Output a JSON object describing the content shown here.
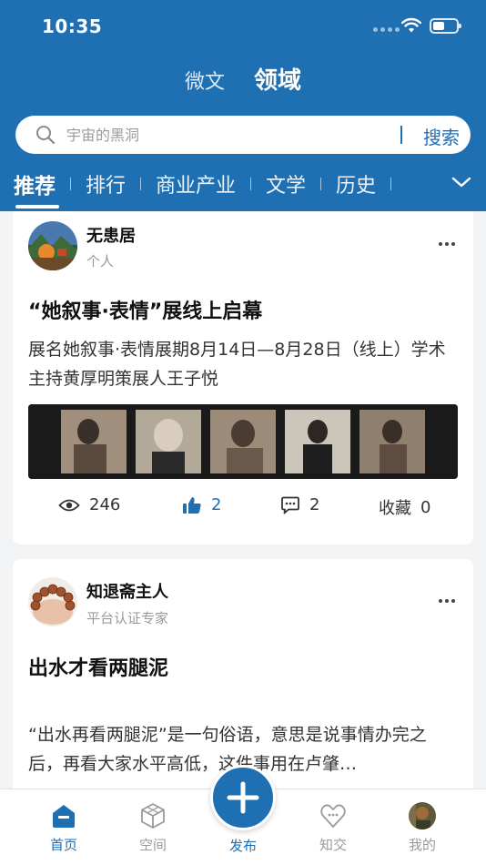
{
  "status_bar": {
    "time": "10:35"
  },
  "header": {
    "tabs": [
      {
        "label": "微文",
        "active": false
      },
      {
        "label": "领域",
        "active": true
      }
    ],
    "search": {
      "placeholder": "宇宙的黑洞",
      "button_label": "搜索"
    },
    "categories": [
      {
        "label": "推荐",
        "active": true
      },
      {
        "label": "排行",
        "active": false
      },
      {
        "label": "商业产业",
        "active": false
      },
      {
        "label": "文学",
        "active": false
      },
      {
        "label": "历史",
        "active": false
      }
    ],
    "more_icon": "chevron-down-icon"
  },
  "posts": [
    {
      "author": "无患居",
      "subtitle": "个人",
      "title": "“她叙事·表情”展线上启幕",
      "excerpt": "展名她叙事·表情展期8月14日—8月28日（线上）学术主持黄厚明策展人王子悦",
      "stats": {
        "views": "246",
        "likes": "2",
        "comments": "2",
        "favorite_label": "收藏",
        "favorites": "0"
      }
    },
    {
      "author": "知退斋主人",
      "subtitle": "平台认证专家",
      "title": "出水才看两腿泥",
      "excerpt": "“出水再看两腿泥”是一句俗语，意思是说事情办完之后，再看大家水平高低，这件事用在卢肇…"
    }
  ],
  "tabbar": {
    "items": [
      {
        "label": "首页",
        "icon": "home-icon",
        "active": true
      },
      {
        "label": "空间",
        "icon": "cube-icon",
        "active": false
      },
      {
        "label": "发布",
        "icon": "plus-icon",
        "active": false
      },
      {
        "label": "知交",
        "icon": "heart-chat-icon",
        "active": false
      },
      {
        "label": "我的",
        "icon": "avatar-icon",
        "active": false
      }
    ]
  },
  "colors": {
    "brand": "#1f6fb3",
    "background": "#f2f3f5"
  }
}
